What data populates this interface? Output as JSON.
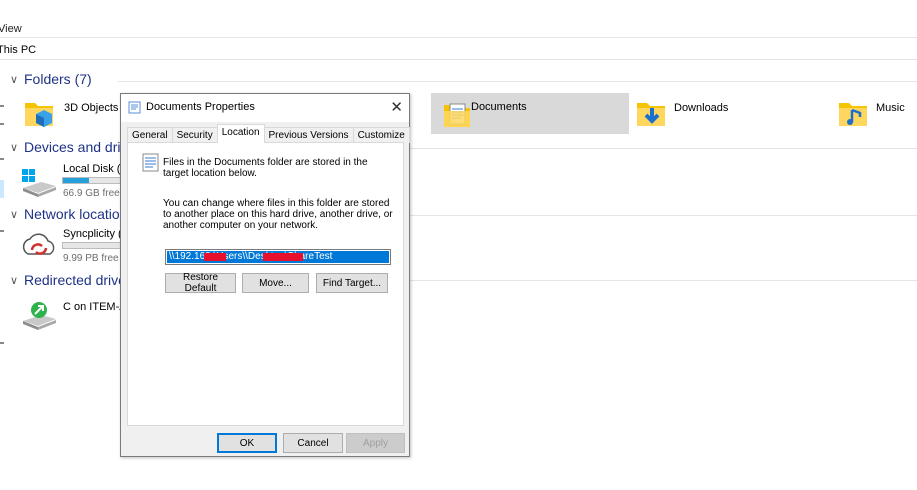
{
  "menu": {
    "view_label": "View"
  },
  "address": {
    "path": "This PC"
  },
  "groups": {
    "folders": "Folders (7)",
    "devices": "Devices and drives",
    "network": "Network locations",
    "redirected": "Redirected drives a"
  },
  "folders": [
    {
      "name": "3D Objects",
      "icon": "3d-objects-folder-icon"
    },
    {
      "name": "Documents",
      "icon": "documents-folder-icon",
      "selected": true
    },
    {
      "name": "Downloads",
      "icon": "downloads-folder-icon"
    },
    {
      "name": "Music",
      "icon": "music-folder-icon"
    }
  ],
  "drives": [
    {
      "name": "Local Disk (C:",
      "free": "66.9 GB free o",
      "usage_fraction": 0.45,
      "icon": "local-disk-icon"
    }
  ],
  "network_locations": [
    {
      "name": "Syncplicity (Sy",
      "free": "9.99 PB free o",
      "usage_fraction": 0.0,
      "icon": "syncplicity-icon"
    }
  ],
  "redirected_drives": [
    {
      "name": "C on ITEM-AX",
      "icon": "network-drive-icon"
    }
  ],
  "dialog": {
    "title": "Documents Properties",
    "tabs": [
      "General",
      "Security",
      "Location",
      "Previous Versions",
      "Customize"
    ],
    "active_tab": "Location",
    "info_text": "Files in the Documents folder are stored in the target location below.",
    "change_text": "You can change where files in this folder are stored to another place on this hard drive, another drive, or another computer on your network.",
    "path_value": "\\\\192.168.\\Users\\\\Desktop\\ShareTest",
    "buttons": {
      "restore_default": "Restore Default",
      "move": "Move...",
      "find_target": "Find Target...",
      "ok": "OK",
      "cancel": "Cancel",
      "apply": "Apply"
    }
  },
  "colors": {
    "group_heading": "#1e3287",
    "selection": "#0078d7",
    "redaction": "#e8112d",
    "drive_bar": "#26a0da"
  }
}
